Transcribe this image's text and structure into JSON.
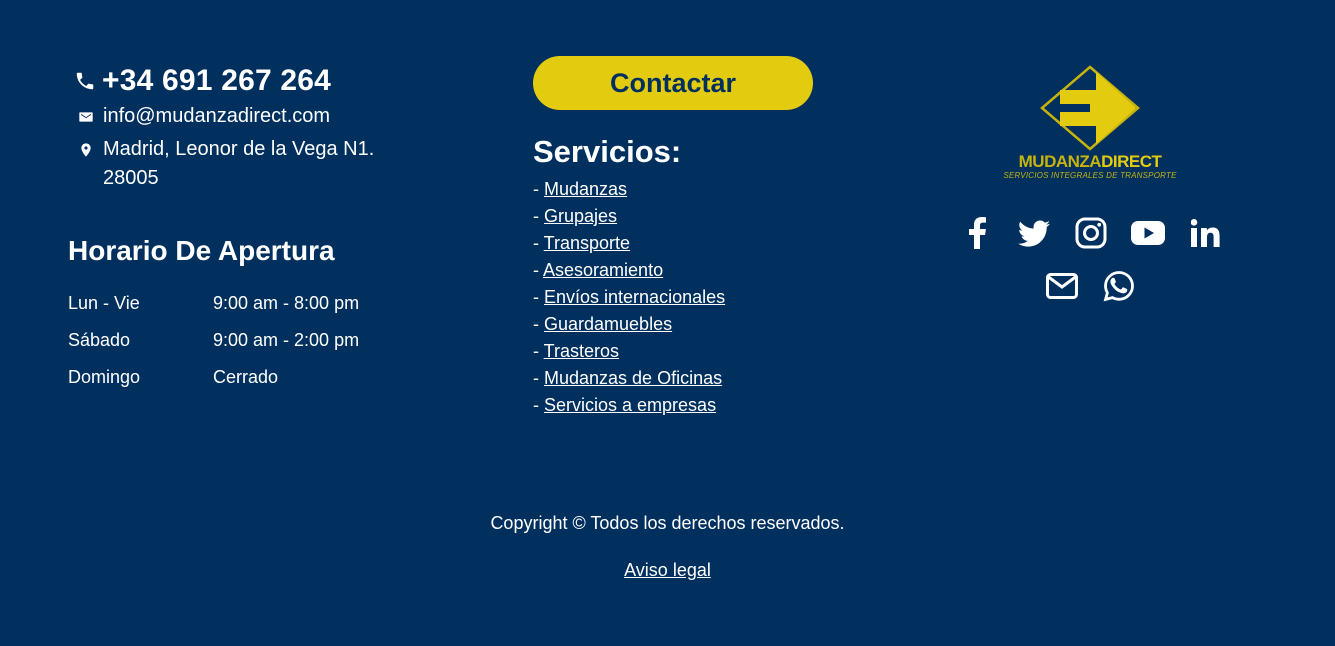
{
  "contact": {
    "phone": "+34 691 267 264",
    "email": "info@mudanzadirect.com",
    "address": "Madrid, Leonor de la Vega N1. 28005"
  },
  "hours": {
    "title": "Horario De Apertura",
    "rows": [
      {
        "day": "Lun - Vie",
        "time": "9:00 am - 8:00 pm"
      },
      {
        "day": "Sábado",
        "time": "9:00 am - 2:00 pm"
      },
      {
        "day": "Domingo",
        "time": "Cerrado"
      }
    ]
  },
  "cta": {
    "label": "Contactar"
  },
  "services": {
    "title": "Servicios:",
    "prefix": "- ",
    "items": [
      "Mudanzas",
      "Grupajes",
      "Transporte",
      "Asesoramiento",
      "Envíos internacionales",
      "Guardamuebles",
      "Trasteros",
      "Mudanzas de Oficinas",
      "Servicios a empresas"
    ]
  },
  "brand": {
    "name_light": "MUDANZA",
    "name_bold": "DIRECT",
    "tagline": "SERVICIOS INTEGRALES DE TRANSPORTE",
    "color": "#e3cc10"
  },
  "social": {
    "icons": [
      "facebook-icon",
      "twitter-icon",
      "instagram-icon",
      "youtube-icon",
      "linkedin-icon",
      "email-icon",
      "whatsapp-icon"
    ]
  },
  "footer": {
    "copyright": "Copyright © Todos los derechos reservados.",
    "legal_link": "Aviso legal"
  },
  "colors": {
    "background": "#01305f",
    "accent": "#e3cc10",
    "text": "#ffffff"
  }
}
